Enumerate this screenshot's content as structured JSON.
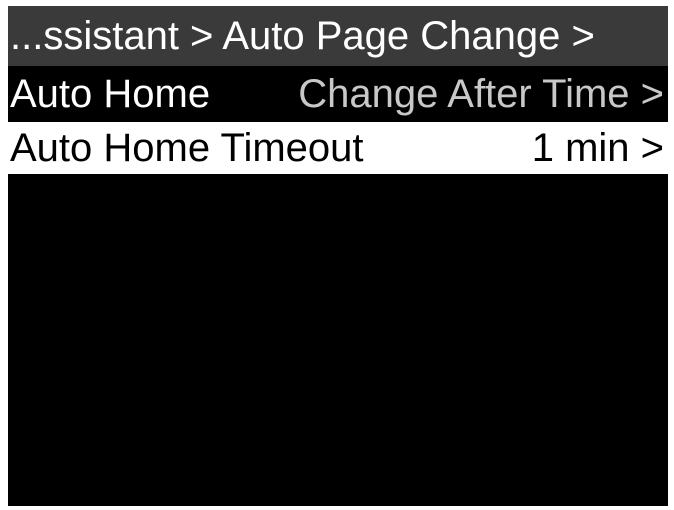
{
  "header": {
    "breadcrumb": "...ssistant > Auto Page Change >"
  },
  "menu": {
    "items": [
      {
        "label": "Auto Home",
        "value": "Change After Time >"
      },
      {
        "label": "Auto Home Timeout",
        "value": "1 min >"
      }
    ],
    "selected_index": 1
  },
  "colors": {
    "screen_background": "#000000",
    "header_background": "#3a3a3a",
    "selected_background": "#ffffff",
    "text_primary": "#ffffff",
    "text_secondary": "#c8c8c8"
  }
}
